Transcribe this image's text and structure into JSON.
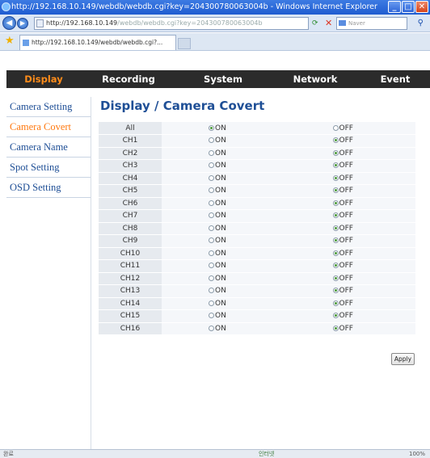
{
  "window": {
    "title": "http://192.168.10.149/webdb/webdb.cgi?key=204300780063004b - Windows Internet Explorer"
  },
  "addressbar": {
    "url_host": "http://192.168.10.149",
    "url_path": "/webdb/webdb.cgi?key=204300780063004b",
    "search_placeholder": "Naver"
  },
  "tab": {
    "label": "http://192.168.10.149/webdb/webdb.cgi?..."
  },
  "mainnav": {
    "items": [
      "Display",
      "Recording",
      "System",
      "Network",
      "Event"
    ],
    "active": "Display"
  },
  "sidebar": {
    "items": [
      "Camera Setting",
      "Camera Covert",
      "Camera Name",
      "Spot Setting",
      "OSD Setting"
    ],
    "active": "Camera Covert"
  },
  "page_title": "Display / Camera Covert",
  "options": {
    "on_label": "ON",
    "off_label": "OFF"
  },
  "rows": [
    {
      "label": "All",
      "state": "ON"
    },
    {
      "label": "CH1",
      "state": "OFF"
    },
    {
      "label": "CH2",
      "state": "OFF"
    },
    {
      "label": "CH3",
      "state": "OFF"
    },
    {
      "label": "CH4",
      "state": "OFF"
    },
    {
      "label": "CH5",
      "state": "OFF"
    },
    {
      "label": "CH6",
      "state": "OFF"
    },
    {
      "label": "CH7",
      "state": "OFF"
    },
    {
      "label": "CH8",
      "state": "OFF"
    },
    {
      "label": "CH9",
      "state": "OFF"
    },
    {
      "label": "CH10",
      "state": "OFF"
    },
    {
      "label": "CH11",
      "state": "OFF"
    },
    {
      "label": "CH12",
      "state": "OFF"
    },
    {
      "label": "CH13",
      "state": "OFF"
    },
    {
      "label": "CH14",
      "state": "OFF"
    },
    {
      "label": "CH15",
      "state": "OFF"
    },
    {
      "label": "CH16",
      "state": "OFF"
    }
  ],
  "apply_label": "Apply",
  "statusbar": {
    "left": "완료",
    "zone": "인터넷",
    "zoom": "100%"
  },
  "icons": {
    "back": "back-arrow-icon",
    "forward": "forward-arrow-icon",
    "refresh": "refresh-icon",
    "stop": "stop-icon",
    "favorites": "star-icon"
  },
  "colors": {
    "nav_bg": "#2b2b2b",
    "nav_active": "#ff8c1a",
    "link_blue": "#1f4f96",
    "sidebar_active": "#ff7a12"
  }
}
